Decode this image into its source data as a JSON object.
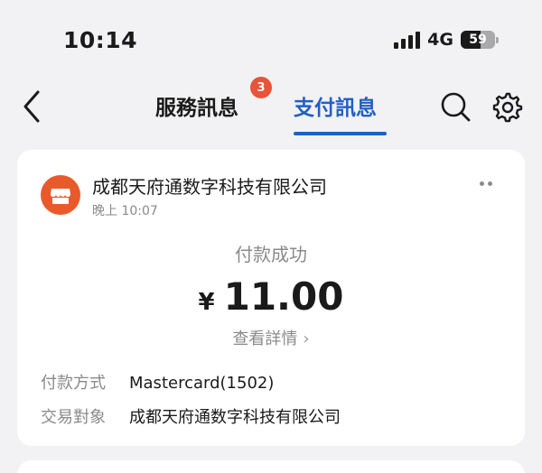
{
  "status_bar": {
    "time": "10:14",
    "network": "4G",
    "battery": "59",
    "battery_level": 0.59
  },
  "nav": {
    "tab_service": "服務訊息",
    "service_badge": "3",
    "tab_pay": "支付訊息",
    "active_color": "#2160c4"
  },
  "card": {
    "merchant": "成都天府通数字科技有限公司",
    "time": "晚上 10:07",
    "status": "付款成功",
    "currency": "¥",
    "amount": "11.00",
    "details_link": "查看詳情",
    "fields": [
      {
        "label": "付款方式",
        "value": "Mastercard(1502)"
      },
      {
        "label": "交易對象",
        "value": "成都天府通数字科技有限公司"
      }
    ],
    "avatar_color": "#e95a2a"
  }
}
